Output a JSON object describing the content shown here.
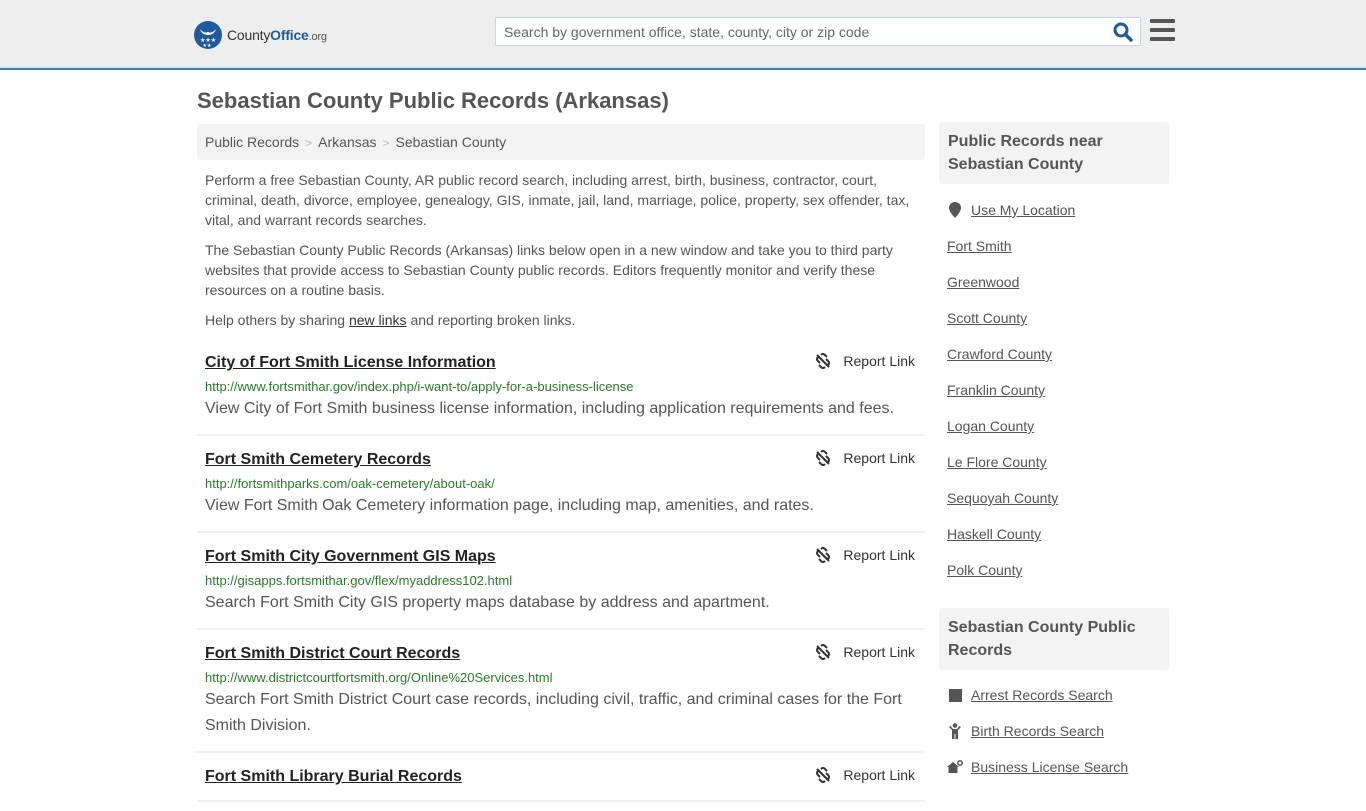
{
  "header": {
    "logo": {
      "county": "County",
      "office": "Office",
      "org": ".org"
    },
    "search": {
      "placeholder": "Search by government office, state, county, city or zip code",
      "value": ""
    },
    "brand_color": "#1f5b9c",
    "accent_line_color": "#3a7bb0"
  },
  "page": {
    "title": "Sebastian County Public Records (Arkansas)"
  },
  "breadcrumb": [
    {
      "label": "Public Records"
    },
    {
      "label": "Arkansas"
    },
    {
      "label": "Sebastian County"
    }
  ],
  "intro": {
    "p1": "Perform a free Sebastian County, AR public record search, including arrest, birth, business, contractor, court, criminal, death, divorce, employee, genealogy, GIS, inmate, jail, land, marriage, police, property, sex offender, tax, vital, and warrant records searches.",
    "p2": "The Sebastian County Public Records (Arkansas) links below open in a new window and take you to third party websites that provide access to Sebastian County public records. Editors frequently monitor and verify these resources on a routine basis.",
    "p3_before": "Help others by sharing ",
    "p3_link": "new links",
    "p3_after": " and reporting broken links."
  },
  "report_label": "Report Link",
  "results": [
    {
      "title": "City of Fort Smith License Information",
      "url": "http://www.fortsmithar.gov/index.php/i-want-to/apply-for-a-business-license",
      "desc": "View City of Fort Smith business license information, including application requirements and fees."
    },
    {
      "title": "Fort Smith Cemetery Records",
      "url": "http://fortsmithparks.com/oak-cemetery/about-oak/",
      "desc": "View Fort Smith Oak Cemetery information page, including map, amenities, and rates."
    },
    {
      "title": "Fort Smith City Government GIS Maps",
      "url": "http://gisapps.fortsmithar.gov/flex/myaddress102.html",
      "desc": "Search Fort Smith City GIS property maps database by address and apartment."
    },
    {
      "title": "Fort Smith District Court Records",
      "url": "http://www.districtcourtfortsmith.org/Online%20Services.html",
      "desc": "Search Fort Smith District Court case records, including civil, traffic, and criminal cases for the Fort Smith Division."
    },
    {
      "title": "Fort Smith Library Burial Records",
      "url": "",
      "desc": ""
    }
  ],
  "sidebar": {
    "nearby": {
      "heading": "Public Records near Sebastian County",
      "use_location": "Use My Location",
      "links": [
        "Fort Smith",
        "Greenwood",
        "Scott County",
        "Crawford County",
        "Franklin County",
        "Logan County",
        "Le Flore County",
        "Sequoyah County",
        "Haskell County",
        "Polk County"
      ]
    },
    "county_records": {
      "heading": "Sebastian County Public Records",
      "links": [
        {
          "label": "Arrest Records Search",
          "icon": "square-icon"
        },
        {
          "label": "Birth Records Search",
          "icon": "child-icon"
        },
        {
          "label": "Business License Search",
          "icon": "business-icon"
        }
      ]
    }
  }
}
